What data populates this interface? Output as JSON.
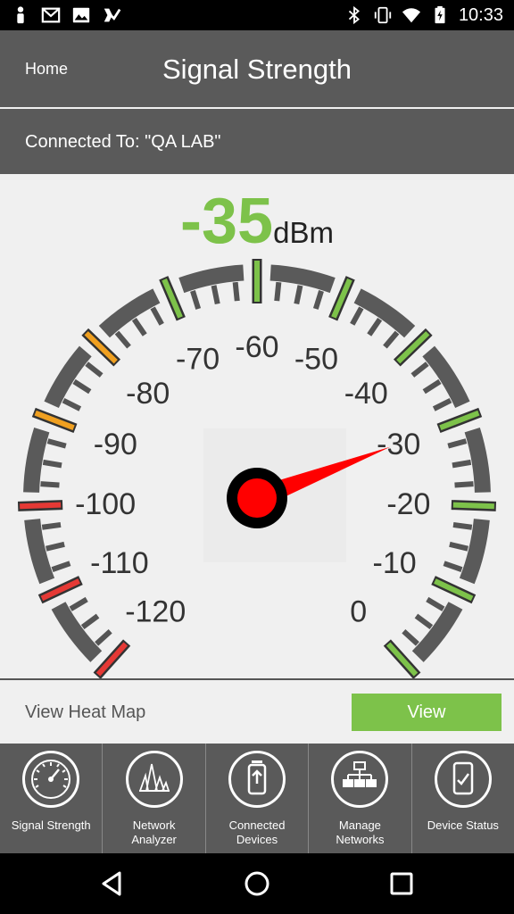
{
  "status_bar": {
    "time": "10:33",
    "left_icons": [
      "person-icon",
      "gmail-icon",
      "image-icon",
      "check-tag-icon"
    ],
    "right_icons": [
      "bluetooth-icon",
      "vibrate-icon",
      "wifi-icon",
      "battery-icon"
    ]
  },
  "app_bar": {
    "home_label": "Home",
    "title": "Signal Strength"
  },
  "connection": {
    "label": "Connected To: \"QA LAB\""
  },
  "gauge": {
    "reading_value": "-35",
    "reading_unit": "dBm",
    "needle_value": -30,
    "scale_min": -120,
    "scale_max": 0,
    "tick_labels": [
      "-120",
      "-110",
      "-100",
      "-90",
      "-80",
      "-70",
      "-60",
      "-50",
      "-40",
      "-30",
      "-20",
      "-10",
      "0"
    ],
    "colors": {
      "reading": "#7dc24a",
      "needle": "#ff0000",
      "tick_red": "#e53935",
      "tick_orange": "#f0a020",
      "tick_green": "#7dc24a",
      "tick_gray": "#555555"
    }
  },
  "heat_map": {
    "label": "View Heat Map",
    "button_label": "View"
  },
  "tabs": [
    {
      "label": "Signal Strength",
      "icon": "speedometer-icon"
    },
    {
      "label": "Network\nAnalyzer",
      "icon": "spectrum-icon"
    },
    {
      "label": "Connected\nDevices",
      "icon": "phone-upload-icon"
    },
    {
      "label": "Manage\nNetworks",
      "icon": "network-tree-icon"
    },
    {
      "label": "Device Status",
      "icon": "phone-check-icon"
    }
  ],
  "nav_bar": {
    "buttons": [
      "back-icon",
      "home-icon",
      "recents-icon"
    ]
  }
}
